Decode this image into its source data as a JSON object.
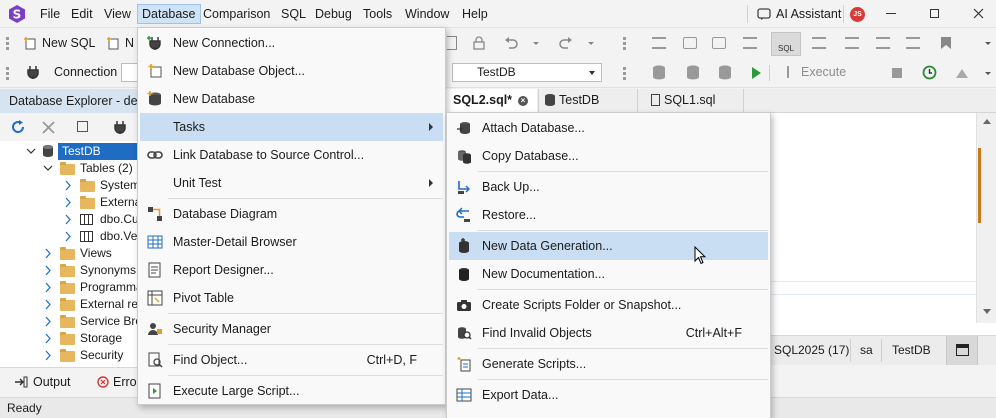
{
  "app": {
    "logo": "devart-s-logo"
  },
  "menubar": {
    "items": [
      "File",
      "Edit",
      "View",
      "Database",
      "Comparison",
      "SQL",
      "Debug",
      "Tools",
      "Window",
      "Help"
    ],
    "ai_assistant": "AI Assistant",
    "user_initials": "JS"
  },
  "toolbar1": {
    "new_sql": "New SQL",
    "truncated": "N"
  },
  "toolbar2": {
    "connection_label": "Connection",
    "database_select": "TestDB",
    "execute": "Execute"
  },
  "explorer": {
    "title": "Database Explorer - dem",
    "tree": [
      {
        "label": "TestDB"
      },
      {
        "label": "Tables (2)"
      },
      {
        "label": "System"
      },
      {
        "label": "Externa"
      },
      {
        "label": "dbo.Cu"
      },
      {
        "label": "dbo.Ver"
      },
      {
        "label": "Views"
      },
      {
        "label": "Synonyms"
      },
      {
        "label": "Programma"
      },
      {
        "label": "External res"
      },
      {
        "label": "Service Bro"
      },
      {
        "label": "Storage"
      },
      {
        "label": "Security"
      }
    ]
  },
  "editor_tabs": [
    "SQL2.sql*",
    "TestDB",
    "SQL1.sql"
  ],
  "status_right": {
    "server": "SQL2025 (17)",
    "user": "sa",
    "database": "TestDB"
  },
  "bottom_tabs": {
    "output": "Output",
    "errors": "Erro"
  },
  "statusbar": {
    "text": "Ready"
  },
  "database_menu": {
    "items": [
      {
        "label": "New Connection...",
        "icon": "new-connection-icon"
      },
      {
        "label": "New Database Object...",
        "icon": "new-object-icon"
      },
      {
        "label": "New Database",
        "icon": "new-database-icon"
      },
      {
        "label": "Tasks",
        "icon": "none",
        "submenu": true
      },
      {
        "label": "Link Database to Source Control...",
        "icon": "link-icon"
      },
      {
        "label": "Unit Test",
        "icon": "none",
        "submenu": true
      },
      {
        "label": "Database Diagram",
        "icon": "diagram-icon"
      },
      {
        "label": "Master-Detail Browser",
        "icon": "grid-icon"
      },
      {
        "label": "Report Designer...",
        "icon": "report-icon"
      },
      {
        "label": "Pivot Table",
        "icon": "pivot-icon"
      },
      {
        "label": "Security Manager",
        "icon": "security-icon"
      },
      {
        "label": "Find Object...",
        "shortcut": "Ctrl+D, F",
        "icon": "find-icon"
      },
      {
        "label": "Execute Large Script...",
        "icon": "script-icon"
      }
    ]
  },
  "tasks_menu": {
    "items": [
      {
        "label": "Attach Database..."
      },
      {
        "label": "Copy Database..."
      },
      {
        "label": "Back Up..."
      },
      {
        "label": "Restore..."
      },
      {
        "label": "New Data Generation..."
      },
      {
        "label": "New Documentation..."
      },
      {
        "label": "Create Scripts Folder or Snapshot..."
      },
      {
        "label": "Find Invalid Objects",
        "shortcut": "Ctrl+Alt+F"
      },
      {
        "label": "Generate Scripts..."
      },
      {
        "label": "Export Data..."
      }
    ]
  }
}
